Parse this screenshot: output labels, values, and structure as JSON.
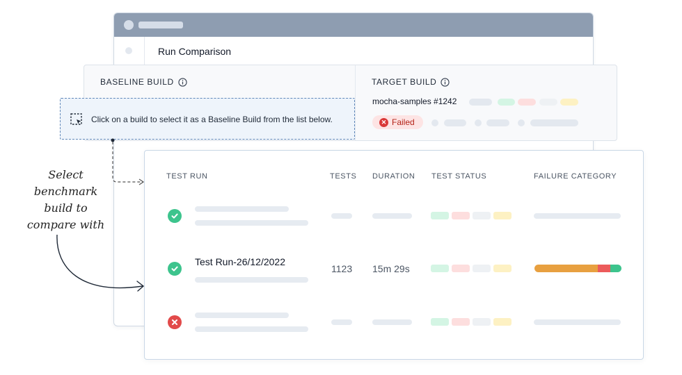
{
  "page": {
    "title": "Run Comparison"
  },
  "baseline": {
    "title": "BASELINE BUILD",
    "callout": "Click on a build to select it as a Baseline Build from the list below."
  },
  "target": {
    "title": "TARGET BUILD",
    "build_name": "mocha-samples #1242",
    "status": "Failed"
  },
  "table": {
    "headers": {
      "test_run": "TEST RUN",
      "tests": "TESTS",
      "duration": "DURATION",
      "test_status": "TEST STATUS",
      "failure_category": "FAILURE CATEGORY"
    },
    "rows": [
      {
        "status": "passed",
        "status_icon": "check-circle-icon"
      },
      {
        "status": "passed",
        "status_icon": "check-circle-icon",
        "name": "Test Run-26/12/2022",
        "tests": "1123",
        "duration": "15m 29s"
      },
      {
        "status": "failed",
        "status_icon": "x-circle-icon"
      }
    ]
  },
  "annotation": {
    "lines": [
      "Select",
      "benchmark",
      "build to",
      "compare with"
    ]
  },
  "colors": {
    "titlebar": "#8e9db1",
    "pass": "#3dc48d",
    "fail": "#e24a4a",
    "status_green": "#d4f5e4",
    "status_red": "#fddede",
    "status_gray": "#eef1f4",
    "status_yellow": "#fdf1c3",
    "failure_orange": "#e8a040",
    "failure_red": "#ec5b5b",
    "failure_green": "#3dc48d"
  }
}
